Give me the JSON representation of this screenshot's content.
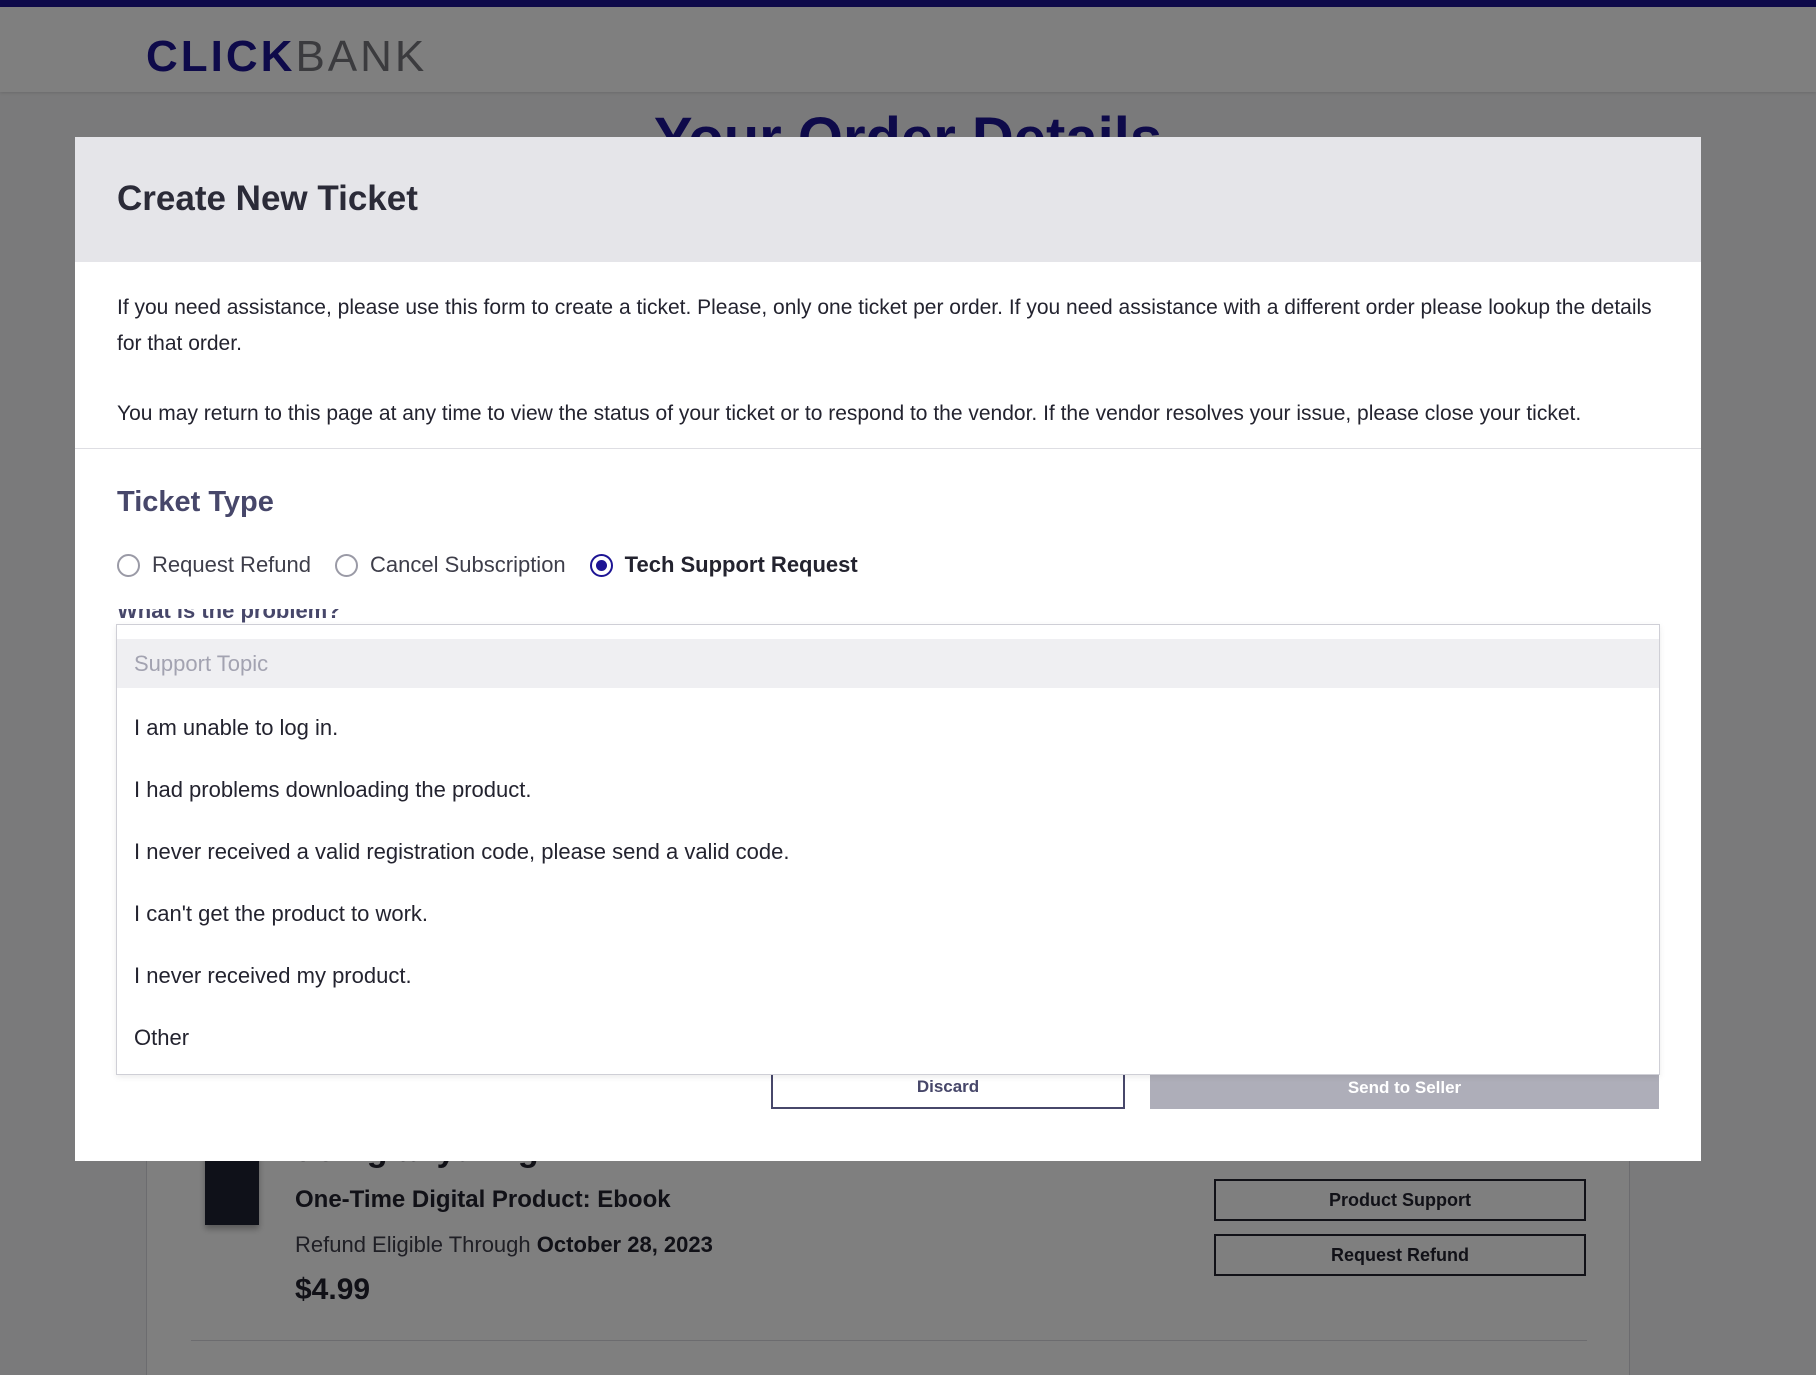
{
  "header": {
    "logo_click": "CLICK",
    "logo_bank": "BANK"
  },
  "background": {
    "page_heading": "Your Order Details",
    "order": {
      "product_title": "doing anything",
      "product_type": "One-Time Digital Product: Ebook",
      "refund_eligible_prefix": "Refund Eligible Through ",
      "refund_eligible_date": "October 28, 2023",
      "price": "$4.99",
      "product_support_label": "Product Support",
      "request_refund_label": "Request Refund"
    }
  },
  "modal": {
    "title": "Create New Ticket",
    "intro_1": "If you need assistance, please use this form to create a ticket. Please, only one ticket per order. If you need assistance with a different order please lookup the details for that order.",
    "intro_2": "You may return to this page at any time to view the status of your ticket or to respond to the vendor. If the vendor resolves your issue, please close your ticket.",
    "ticket_type_heading": "Ticket Type",
    "ticket_types": [
      {
        "label": "Request Refund",
        "selected": false
      },
      {
        "label": "Cancel Subscription",
        "selected": false
      },
      {
        "label": "Tech Support Request",
        "selected": true
      }
    ],
    "hidden_question": "What is the problem?",
    "support_topic": {
      "placeholder": "Support Topic",
      "options": [
        "I am unable to log in.",
        "I had problems downloading the product.",
        "I never received a valid registration code, please send a valid code.",
        "I can't get the product to work.",
        "I never received my product.",
        "Other"
      ]
    },
    "discard_label": "Discard",
    "send_label": "Send to Seller"
  },
  "colors": {
    "brand": "#1d1494",
    "disabled_button": "#aeaeb9"
  }
}
